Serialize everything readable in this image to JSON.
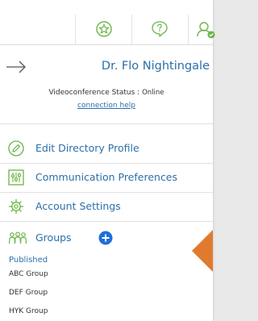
{
  "header": {
    "icons": [
      "star-badge-icon",
      "question-bubble-icon",
      "user-status-icon"
    ]
  },
  "profile": {
    "name": "Dr. Flo Nightingale",
    "status_label": "Videoconference Status :",
    "status_value": "Online",
    "help_link": "connection help"
  },
  "menu": {
    "items": [
      {
        "label": "Edit Directory Profile",
        "icon": "pencil-circle-icon"
      },
      {
        "label": "Communication Preferences",
        "icon": "sliders-icon"
      },
      {
        "label": "Account Settings",
        "icon": "gear-icon"
      }
    ]
  },
  "groups": {
    "label": "Groups",
    "section_label": "Published",
    "items": [
      "ABC Group",
      "DEF Group",
      "HYK Group"
    ]
  },
  "colors": {
    "accent": "#2c6fa8",
    "icon_green": "#6bb446",
    "add_button": "#1e6fd9",
    "pointer": "#e07a2f"
  }
}
